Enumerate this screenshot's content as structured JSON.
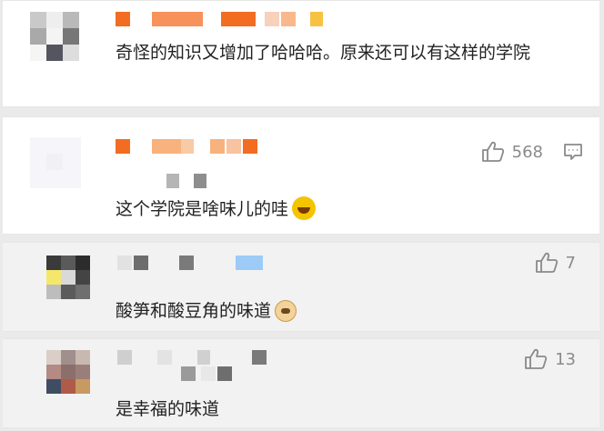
{
  "comments": [
    {
      "text": "奇怪的知识又增加了哈哈哈。原来还可以有这样的学院",
      "likes": null
    },
    {
      "text": "这个学院是啥味儿的哇",
      "emoji": "laughing-tears-emoji",
      "likes": "568"
    },
    {
      "text": "酸笋和酸豆角的味道",
      "emoji": "doge-emoji",
      "likes": "7"
    },
    {
      "text": "是幸福的味道",
      "likes": "13"
    }
  ],
  "icons": {
    "like": "thumbs-up-icon",
    "reply": "comment-icon"
  },
  "colors": {
    "name_orange": "#f26d21",
    "name_light_orange": "#f8b27d",
    "name_yellow": "#f7c242",
    "name_blue": "#9ccbf7",
    "text": "#222222",
    "meta": "#8a8a8a",
    "reply_background": "#f2f2f2"
  }
}
